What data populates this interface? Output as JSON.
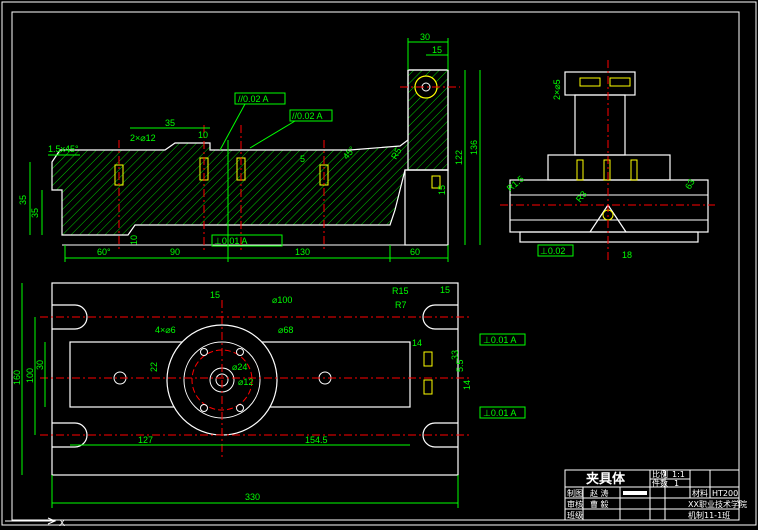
{
  "colors": {
    "background": "#000000",
    "outline": "#ffffff",
    "dimension": "#00ff00",
    "centerline": "#ff0000",
    "hole": "#ffff00",
    "hatch": "#00cc00"
  },
  "front_view": {
    "chamfer": "1.5x45°",
    "holes": "2×⌀12",
    "dims": [
      "35",
      "10",
      "30",
      "15",
      "90",
      "130",
      "60",
      "10",
      "122",
      "136",
      "35",
      "35",
      "15",
      "45°",
      "R5",
      "5",
      "60°"
    ],
    "tol_flat": "//0.02 A",
    "tol_par": "//0.02 A",
    "tol_perp": "⊥0.01 A"
  },
  "side_view": {
    "holes": "2×⌀5",
    "dims": [
      "R1.5",
      "R3",
      "63",
      "18"
    ],
    "tol": "⊥0.02"
  },
  "top_view": {
    "dims": [
      "15",
      "⌀100",
      "⌀68",
      "4×⌀6",
      "R15",
      "R7",
      "15",
      "14",
      "22",
      "30",
      "160",
      "100",
      "33",
      "14",
      "5.5",
      "127",
      "154.5",
      "330",
      "⌀24",
      "⌀12"
    ],
    "tol_top": "⊥0.01 A",
    "tol_bottom": "⊥0.01 A"
  },
  "title_block": {
    "title": "夹具体",
    "scale_label": "比例",
    "scale_value": "1:1",
    "qty_label": "件数",
    "qty_value": "1",
    "material_label": "材料",
    "material_value": "HT200",
    "drawn_label": "制图",
    "drawn_name": "赵 涛",
    "check_label": "审核",
    "check_name": "曹 毅",
    "school": "XX职业技术学院",
    "class_label": "班级",
    "class_value": "机制11-1班"
  }
}
